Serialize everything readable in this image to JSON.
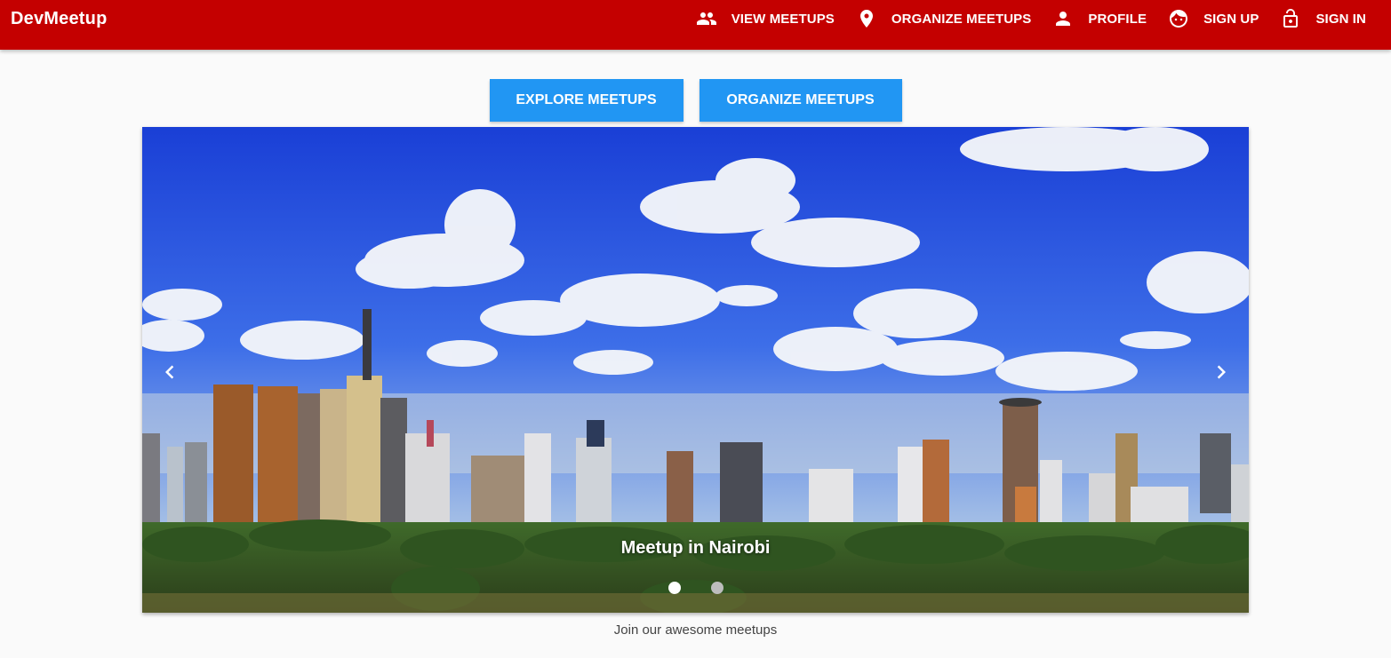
{
  "app": {
    "title": "DevMeetup"
  },
  "nav": {
    "items": [
      {
        "label": "VIEW MEETUPS",
        "icon": "people-icon"
      },
      {
        "label": "ORGANIZE MEETUPS",
        "icon": "location-pin-icon"
      },
      {
        "label": "PROFILE",
        "icon": "person-icon"
      },
      {
        "label": "SIGN UP",
        "icon": "face-icon"
      },
      {
        "label": "SIGN IN",
        "icon": "lock-open-icon"
      }
    ]
  },
  "actions": {
    "explore_label": "EXPLORE MEETUPS",
    "organize_label": "ORGANIZE MEETUPS"
  },
  "carousel": {
    "caption": "Meetup in Nairobi",
    "slide_count": 2,
    "active_index": 0,
    "prev_icon": "chevron-left-icon",
    "next_icon": "chevron-right-icon"
  },
  "footer": {
    "tagline": "Join our awesome meetups"
  },
  "colors": {
    "toolbar": "#c40000",
    "button": "#2196f3",
    "background": "#fafafa",
    "dot_active": "#ffffff",
    "dot_inactive": "#bdbdbd"
  }
}
